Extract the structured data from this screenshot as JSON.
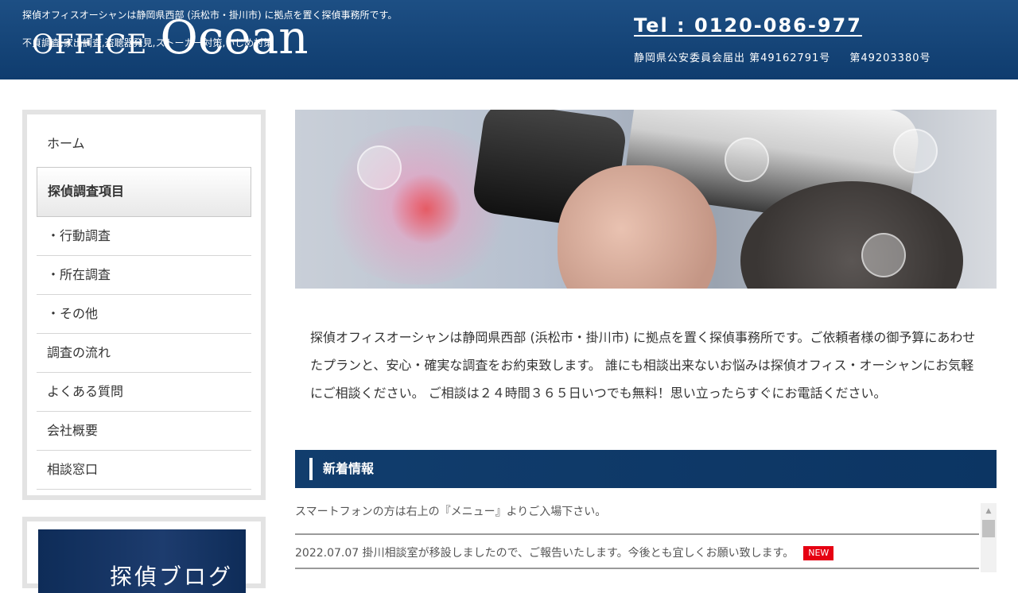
{
  "header": {
    "tagline": "探偵オフィスオーシャンは静岡県西部 (浜松市・掛川市) に拠点を置く探偵事務所です。",
    "logo_office": "OFFICE",
    "logo_ocean": "Ocean",
    "services": "不貞調査,家出調査,盗聴器発見,ストーカー対策,いじめ対策",
    "tel": "Tel : 0120-086-977",
    "license_label": "静岡県公安委員会届出 第49162791号",
    "license_second": "第49203380号"
  },
  "sidebar": {
    "items": [
      {
        "label": "ホーム"
      },
      {
        "label": "探偵調査項目"
      },
      {
        "label": "・行動調査"
      },
      {
        "label": "・所在調査"
      },
      {
        "label": "・その他"
      },
      {
        "label": "調査の流れ"
      },
      {
        "label": "よくある質問"
      },
      {
        "label": "会社概要"
      },
      {
        "label": "相談窓口"
      }
    ],
    "blog_banner": "探偵ブログ"
  },
  "intro": {
    "text": "探偵オフィスオーシャンは静岡県西部 (浜松市・掛川市) に拠点を置く探偵事務所です。ご依頼者様の御予算にあわせたプランと、安心・確実な調査をお約束致します。 誰にも相談出来ないお悩みは探偵オフィス・オーシャンにお気軽にご相談ください。 ご相談は２４時間３６５日いつでも無料！思い立ったらすぐにお電話ください。"
  },
  "news": {
    "heading": "新着情報",
    "items": [
      {
        "text": "スマートフォンの方は右上の『メニュー』よりご入場下さい。"
      },
      {
        "text": "2022.07.07 掛川相談室が移設しましたので、ご報告いたします。今後とも宜しくお願い致します。",
        "badge": "NEW"
      }
    ]
  },
  "colors": {
    "header_bg": "#0f3c6e",
    "news_head_bg": "#0c3563",
    "badge_bg": "#e60012"
  }
}
